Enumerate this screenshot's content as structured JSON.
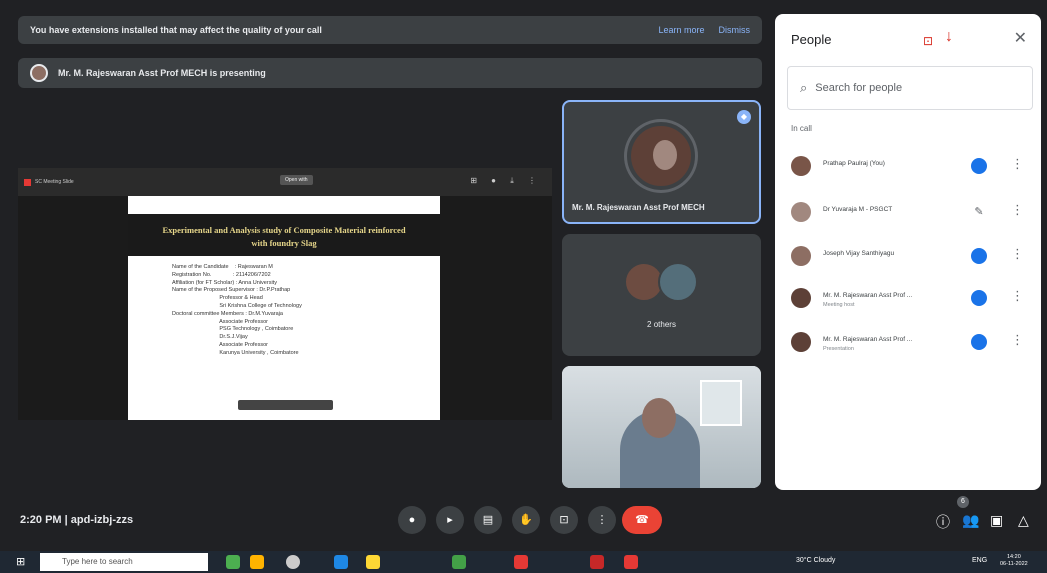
{
  "banner": {
    "text": "You have extensions installed that may affect the quality of your call",
    "learn_more": "Learn more",
    "dismiss": "Dismiss"
  },
  "presenting": {
    "text": "Mr. M. Rajeswaran Asst Prof MECH is presenting"
  },
  "slide_window": {
    "tab_label": "SC Meeting Slide",
    "open_tab": "Open with"
  },
  "slide": {
    "title_line1": "Experimental and Analysis study of Composite Material reinforced",
    "title_line2": "with foundry Slag",
    "body": "Name of the Candidate    : Rajeswaran M\nRegistration No.              : 2114206/7202\nAffiliation (for FT Scholar) : Anna University\nName of the Proposed Supervisor : Dr.P.Prathap\n                               Professor & Head\n                               Sri Krishna College of Technology\nDoctoral committee Members : Dr.M.Yuvaraja\n                               Associate Professor\n                               PSG Technology , Coimbatore\n                               Dr.S.J.Vijay\n                               Associate Professor\n                               Karunya University , Coimbatore"
  },
  "tiles": {
    "presenter_name": "Mr. M. Rajeswaran Asst Prof MECH",
    "others_label": "2 others"
  },
  "people_panel": {
    "title": "People",
    "search_placeholder": "Search for people",
    "section": "In call",
    "participants": [
      {
        "name": "Prathap Paulraj (You)",
        "sub": ""
      },
      {
        "name": "Dr Yuvaraja M - PSGCT",
        "sub": ""
      },
      {
        "name": "Joseph Vijay Santhiyagu",
        "sub": ""
      },
      {
        "name": "Mr. M. Rajeswaran Asst Prof ...",
        "sub": "Meeting host"
      },
      {
        "name": "Mr. M. Rajeswaran Asst Prof ...",
        "sub": "Presentation"
      }
    ]
  },
  "meeting": {
    "time": "2:20 PM",
    "separator": "|",
    "code": "apd-izbj-zzs",
    "people_count": "6"
  },
  "taskbar": {
    "search_placeholder": "Type here to search",
    "weather": "30°C Cloudy",
    "lang": "ENG",
    "time": "14:20",
    "date": "06-11-2022"
  }
}
